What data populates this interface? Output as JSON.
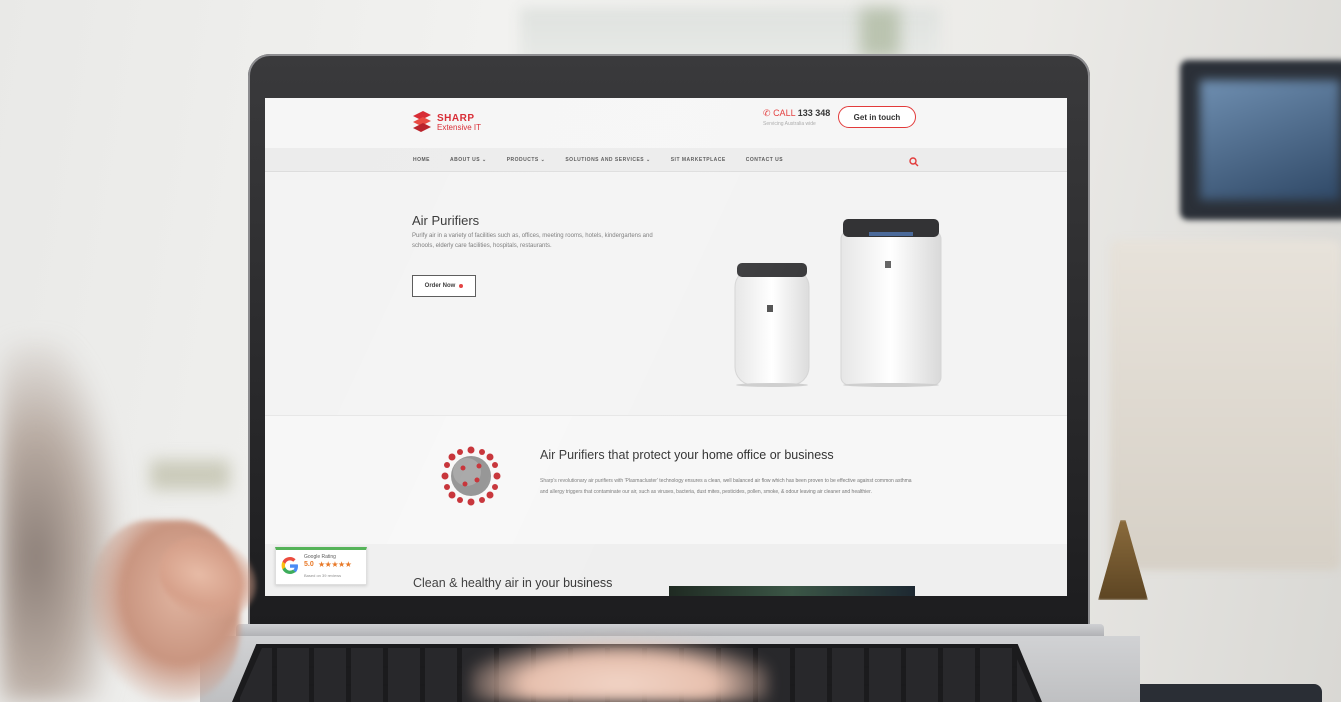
{
  "brand": {
    "name": "SHARP",
    "tagline": "Extensive IT",
    "color": "#d7262f"
  },
  "header": {
    "call_label": "CALL",
    "phone": "133 348",
    "call_sub": "Servicing Australia wide",
    "cta_label": "Get in touch"
  },
  "nav": {
    "items": [
      {
        "label": "HOME"
      },
      {
        "label": "ABOUT US ⌄"
      },
      {
        "label": "PRODUCTS ⌄"
      },
      {
        "label": "SOLUTIONS AND SERVICES ⌄"
      },
      {
        "label": "SIT MARKETPLACE"
      },
      {
        "label": "CONTACT US"
      }
    ],
    "search_icon": "search-icon"
  },
  "hero": {
    "title": "Air Purifiers",
    "description": "Purify air in a variety of facilities such as, offices, meeting rooms, hotels, kindergartens and schools, elderly care facilities, hospitals, restaurants.",
    "order_label": "Order Now"
  },
  "section2": {
    "title": "Air Purifiers that protect your home office or business",
    "description": "Sharp's revolutionary air purifiers with 'Plasmacluster' technology ensures a clean, well balanced air flow which has been proven to be effective against common asthma and allergy triggers that contaminate our air, such as viruses, bacteria, dust mites, pesticides, pollen, smoke, & odour leaving air cleaner and healthier."
  },
  "section3": {
    "title": "Clean & healthy air in your business"
  },
  "google_badge": {
    "logo": "G",
    "title": "Google Rating",
    "score": "5.0",
    "stars": "★★★★★",
    "sub": "Based on 39 reviews"
  },
  "colors": {
    "accent": "#e23a3a",
    "badge_green": "#4caf50",
    "star": "#e7711b"
  }
}
